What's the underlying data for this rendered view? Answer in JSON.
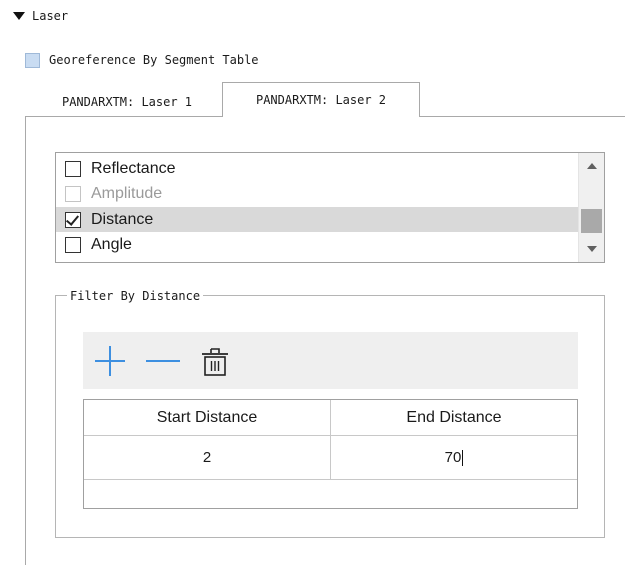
{
  "section": {
    "title": "Laser"
  },
  "georeference": {
    "label": "Georeference By Segment Table",
    "checked": false
  },
  "tabs": [
    {
      "label": "PANDARXTM: Laser 1",
      "active": false
    },
    {
      "label": "PANDARXTM: Laser 2",
      "active": true
    }
  ],
  "attribute_list": {
    "items": [
      {
        "label": "Reflectance",
        "checked": false,
        "enabled": true,
        "selected": false
      },
      {
        "label": "Amplitude",
        "checked": false,
        "enabled": false,
        "selected": false
      },
      {
        "label": "Distance",
        "checked": true,
        "enabled": true,
        "selected": true
      },
      {
        "label": "Angle",
        "checked": false,
        "enabled": true,
        "selected": false
      }
    ]
  },
  "filter": {
    "title": "Filter By Distance",
    "toolbar": {
      "add_icon": "plus-icon",
      "remove_icon": "minus-icon",
      "delete_icon": "trash-icon"
    },
    "table": {
      "columns": [
        "Start Distance",
        "End Distance"
      ],
      "rows": [
        {
          "start": "2",
          "end": "70"
        }
      ]
    }
  },
  "colors": {
    "accent": "#3d8fe0",
    "selected_row": "#d9d9d9",
    "checkbox_tint": "#c9dcf2"
  }
}
